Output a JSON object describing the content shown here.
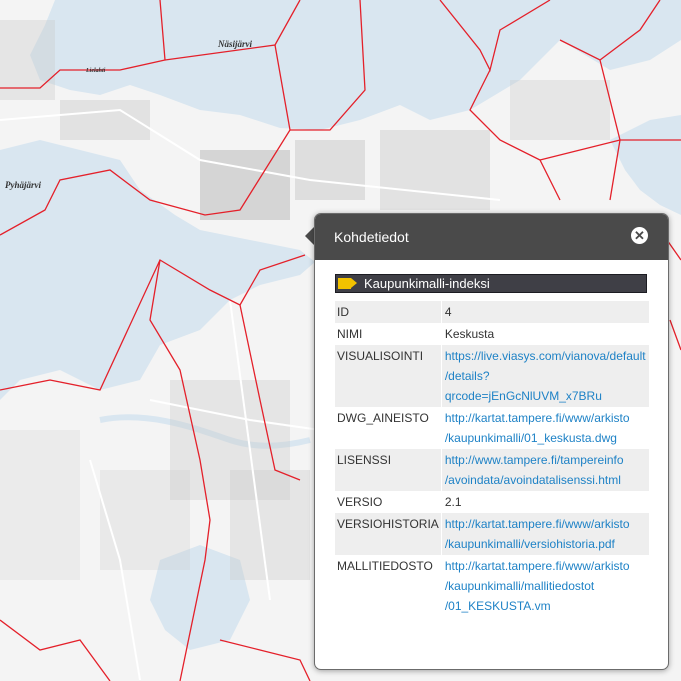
{
  "map": {
    "labels": {
      "nasijarvi": "Näsijärvi",
      "pyhajarvi": "Pyhäjärvi",
      "lielahti": "Lielahti"
    },
    "colors": {
      "water": "#d9e6f0",
      "land": "#f4f4f4",
      "boundary": "#e4202a"
    }
  },
  "popup": {
    "title": "Kohdetiedot",
    "close_icon": "close-icon",
    "layer": {
      "name": "Kaupunkimalli-indeksi",
      "swatch_color": "#f2c200"
    },
    "attributes": [
      {
        "key": "ID",
        "value": "4",
        "link": false
      },
      {
        "key": "NIMI",
        "value": "Keskusta",
        "link": false
      },
      {
        "key": "VISUALISOINTI",
        "line1": "https://live.viasys.com/vianova/default",
        "line2": "/details?qrcode=jEnGcNlUVM_x7BRu",
        "link": true
      },
      {
        "key": "DWG_AINEISTO",
        "line1": "http://kartat.tampere.fi/www/arkisto",
        "line2": "/kaupunkimalli/01_keskusta.dwg",
        "link": true
      },
      {
        "key": "LISENSSI",
        "line1": "http://www.tampere.fi/tampereinfo",
        "line2": "/avoindata/avoindatalisenssi.html",
        "link": true
      },
      {
        "key": "VERSIO",
        "value": "2.1",
        "link": false
      },
      {
        "key": "VERSIOHISTORIA",
        "line1": "http://kartat.tampere.fi/www/arkisto",
        "line2": "/kaupunkimalli/versiohistoria.pdf",
        "link": true
      },
      {
        "key": "MALLITIEDOSTO",
        "line1": "http://kartat.tampere.fi/www/arkisto",
        "line2": "/kaupunkimalli/mallitiedostot",
        "line3": "/01_KESKUSTA.vm",
        "link": true
      }
    ]
  }
}
